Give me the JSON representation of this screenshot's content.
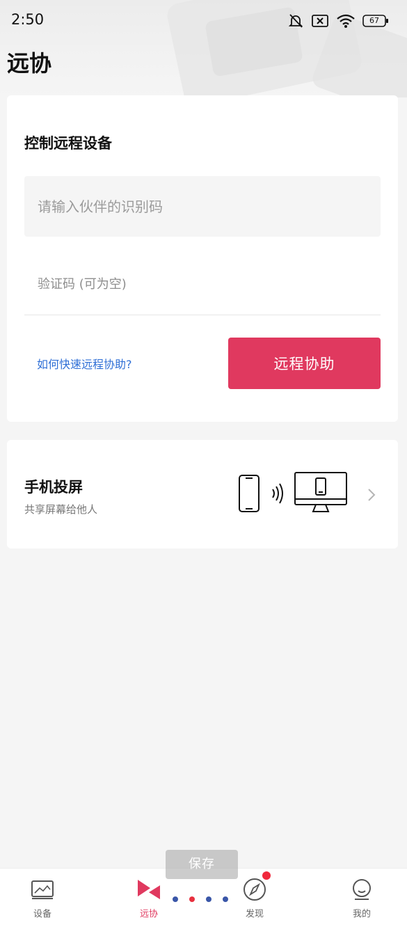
{
  "status_bar": {
    "time": "2:50",
    "battery": "67",
    "icons": [
      "bell-muted-icon",
      "sim-x-icon",
      "wifi-icon",
      "battery-icon"
    ]
  },
  "page": {
    "title": "远协"
  },
  "remote_card": {
    "title": "控制远程设备",
    "partner_code_placeholder": "请输入伙伴的识别码",
    "verify_code_placeholder": "验证码 (可为空)",
    "help_link": "如何快速远程协助?",
    "assist_button": "远程协助"
  },
  "cast_card": {
    "title": "手机投屏",
    "subtitle": "共享屏幕给他人",
    "illustration": "phone-to-monitor-icon",
    "chevron": "chevron-right-icon"
  },
  "bottom_nav": {
    "items": [
      {
        "label": "设备",
        "icon": "devices-icon",
        "active": false
      },
      {
        "label": "远协",
        "icon": "remote-assist-icon",
        "active": true
      },
      {
        "label": "发现",
        "icon": "compass-icon",
        "active": false,
        "badge": true
      },
      {
        "label": "我的",
        "icon": "profile-icon",
        "active": false
      }
    ]
  },
  "toast": {
    "text": "保存"
  },
  "page_dots": {
    "colors": [
      "#3a56a8",
      "#e8303e",
      "#3a56a8",
      "#3a56a8"
    ]
  },
  "colors": {
    "accent": "#e0395f",
    "link": "#2f6fd6",
    "background": "#f5f5f5"
  }
}
